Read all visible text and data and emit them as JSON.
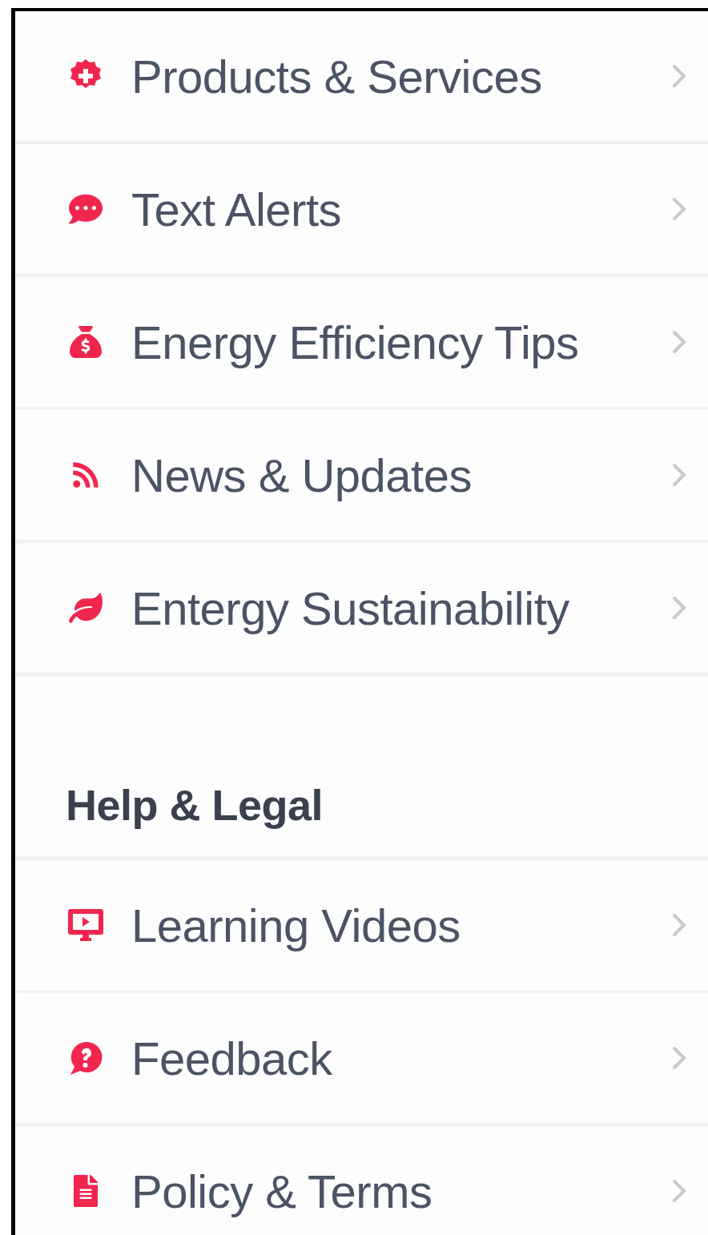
{
  "sections": [
    {
      "items": [
        {
          "label": "Products & Services"
        },
        {
          "label": "Text Alerts"
        },
        {
          "label": "Energy Efficiency Tips"
        },
        {
          "label": "News & Updates"
        },
        {
          "label": "Entergy Sustainability"
        }
      ]
    },
    {
      "title": "Help & Legal",
      "items": [
        {
          "label": "Learning Videos"
        },
        {
          "label": "Feedback"
        },
        {
          "label": "Policy & Terms"
        }
      ]
    }
  ]
}
